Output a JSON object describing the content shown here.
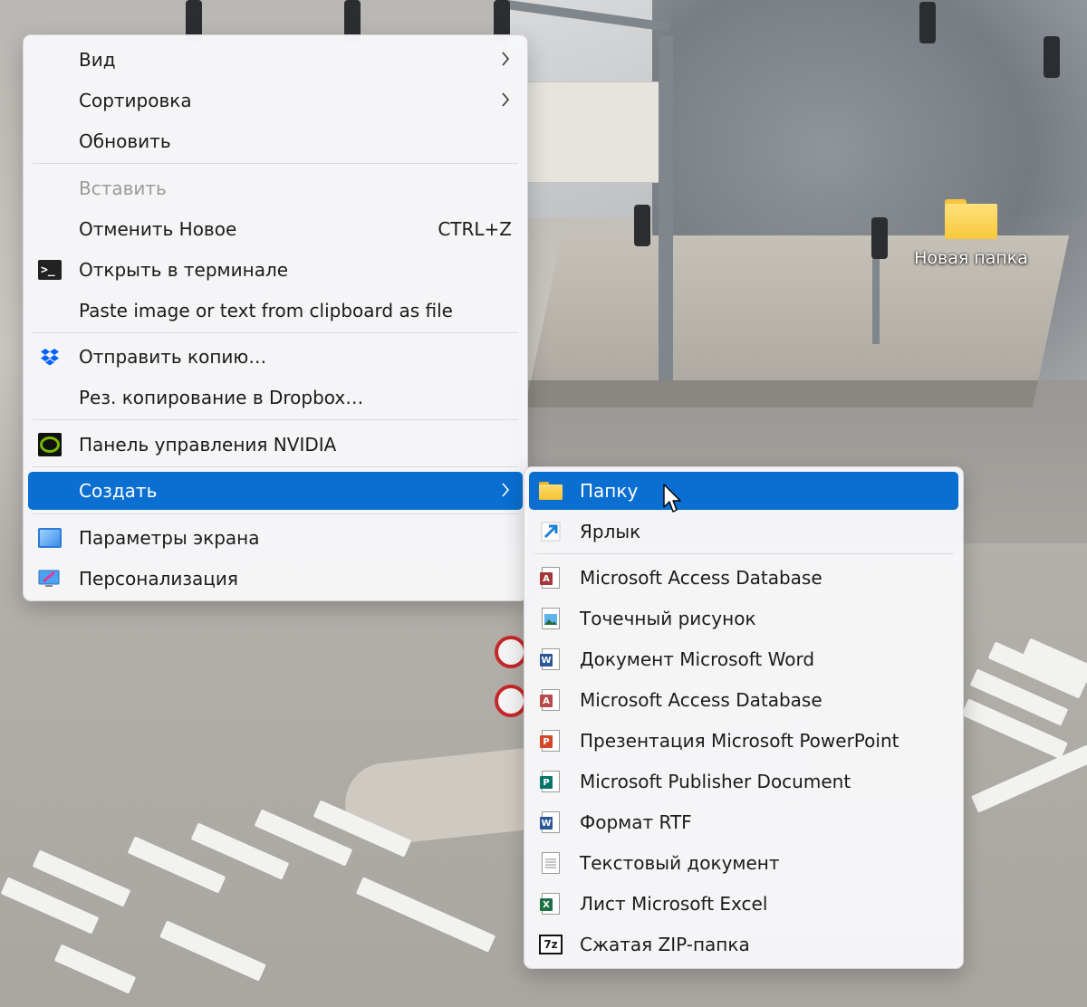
{
  "desktop": {
    "icon_label": "Новая папка"
  },
  "context_menu": {
    "items": [
      {
        "label": "Вид"
      },
      {
        "label": "Сортировка"
      },
      {
        "label": "Обновить"
      },
      {
        "label": "Вставить"
      },
      {
        "label": "Отменить Новое",
        "shortcut": "CTRL+Z"
      },
      {
        "label": "Открыть в терминале",
        "icon": "terminal-icon"
      },
      {
        "label": "Paste image or text from clipboard as file"
      },
      {
        "label": "Отправить копию…",
        "icon": "dropbox-icon"
      },
      {
        "label": "Рез. копирование в Dropbox…"
      },
      {
        "label": "Панель управления NVIDIA",
        "icon": "nvidia-icon"
      },
      {
        "label": "Создать"
      },
      {
        "label": "Параметры экрана",
        "icon": "display-icon"
      },
      {
        "label": "Персонализация",
        "icon": "personalization-icon"
      }
    ]
  },
  "submenu": {
    "items": [
      {
        "label": "Папку",
        "icon": "folder-icon"
      },
      {
        "label": "Ярлык",
        "icon": "shortcut-icon"
      },
      {
        "label": "Microsoft Access Database",
        "icon": "access-icon"
      },
      {
        "label": "Точечный рисунок",
        "icon": "bitmap-icon"
      },
      {
        "label": "Документ Microsoft Word",
        "icon": "word-icon"
      },
      {
        "label": "Microsoft Access Database",
        "icon": "access-icon"
      },
      {
        "label": "Презентация Microsoft PowerPoint",
        "icon": "powerpoint-icon"
      },
      {
        "label": "Microsoft Publisher Document",
        "icon": "publisher-icon"
      },
      {
        "label": "Формат RTF",
        "icon": "rtf-icon"
      },
      {
        "label": "Текстовый документ",
        "icon": "text-document-icon"
      },
      {
        "label": "Лист Microsoft Excel",
        "icon": "excel-icon"
      },
      {
        "label": "Сжатая ZIP-папка",
        "icon": "zip-icon"
      }
    ]
  },
  "colors": {
    "highlight": "#0a6fd1",
    "menu_bg": "#f6f6f8",
    "disabled_text": "#9b9b9b"
  }
}
